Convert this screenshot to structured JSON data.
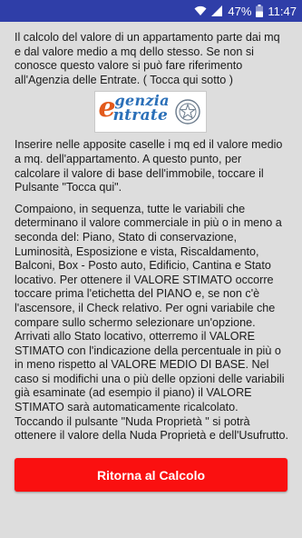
{
  "status_bar": {
    "battery": "47%",
    "time": "11:47",
    "icons": [
      "wifi-icon",
      "signal-icon",
      "battery-icon"
    ]
  },
  "content": {
    "para1": "Il calcolo del valore di un appartamento parte dai mq e dal valore medio a mq dello stesso. Se non si conosce questo valore si può fare riferimento all'Agenzia delle Entrate.   ( Tocca qui sotto )",
    "logo": {
      "line1": "genzia",
      "line2": "ntrate",
      "letter": "e"
    },
    "para2": "Inserire nelle apposite caselle i mq  ed il valore medio a mq. dell'appartamento. A questo punto, per calcolare il valore di base dell'immobile, toccare il Pulsante \"Tocca qui\".",
    "para3": "Compaiono, in sequenza, tutte le variabili che determinano il valore commerciale in più o in meno a seconda del: Piano, Stato di conservazione, Luminosità, Esposizione e vista, Riscaldamento, Balconi, Box - Posto auto, Edificio, Cantina e Stato locativo.  Per ottenere il VALORE STIMATO occorre toccare prima l'etichetta del PIANO e, se non c'è l'ascensore, il Check relativo. Per ogni variabile che compare sullo schermo selezionare un'opzione. Arrivati allo Stato locativo, otterremo il VALORE STIMATO con l'indicazione della percentuale in più o in meno rispetto al VALORE MEDIO DI BASE. Nel caso si modifichi una o più delle opzioni delle variabili già esaminate (ad esempio il piano) il VALORE STIMATO sarà automaticamente ricalcolato. Toccando il pulsante \"Nuda Proprietà \" si potrà ottenere il valore della Nuda Proprietà e dell'Usufrutto."
  },
  "button": {
    "label": "Ritorna al Calcolo",
    "color": "#fa1010"
  },
  "colors": {
    "status_bar": "#2f3ea8",
    "background": "#dddddd",
    "logo_blue": "#2a6fb8",
    "logo_orange": "#e25a1c"
  }
}
